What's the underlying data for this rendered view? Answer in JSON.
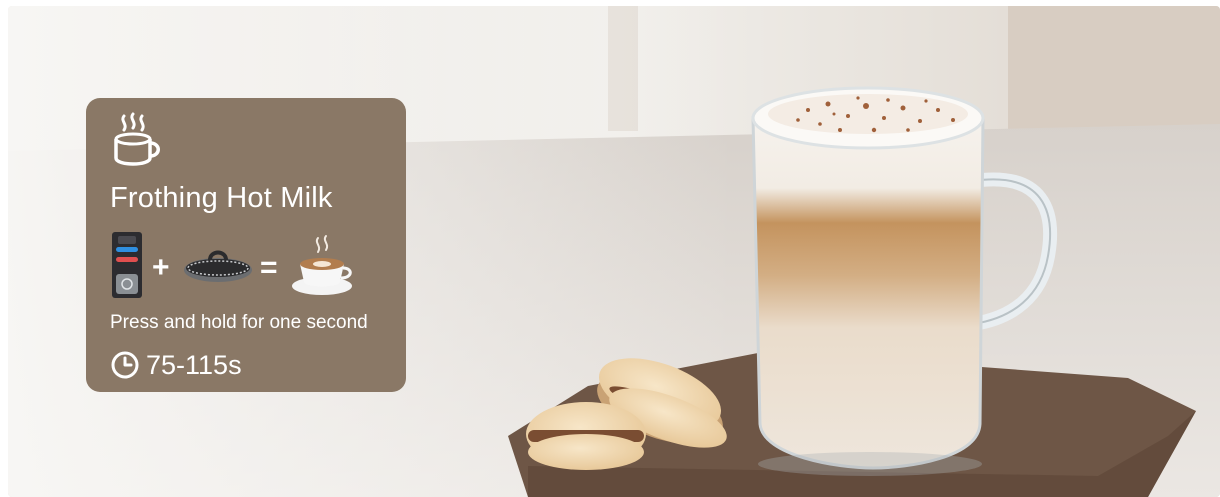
{
  "card": {
    "title": "Frothing Hot Milk",
    "instruction": "Press and hold for one second",
    "duration": "75-115s",
    "background_color": "#8a7866"
  },
  "formula": {
    "plus_symbol": "+",
    "equals_symbol": "=",
    "items": [
      "frother-device-icon",
      "whisk-attachment-icon",
      "latte-cup-icon"
    ]
  },
  "icons": {
    "header": "hot-milk-cup-icon",
    "time": "clock-icon"
  }
}
